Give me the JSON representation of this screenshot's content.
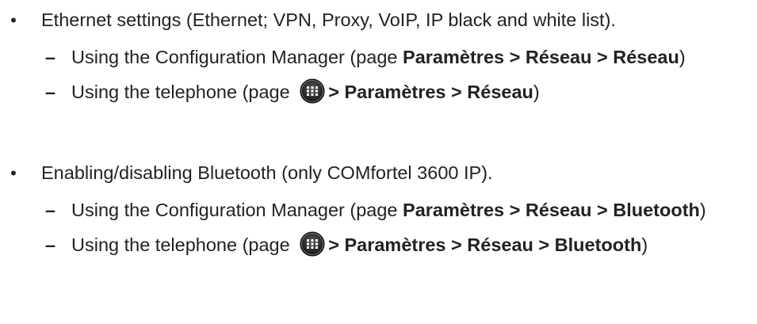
{
  "bullets": [
    {
      "text": "Ethernet settings (Ethernet; VPN, Proxy, VoIP, IP black and white list).",
      "items": [
        {
          "prefix": "Using the Configuration Manager (page ",
          "path": "Paramètres > Réseau > Réseau",
          "suffix": ")"
        },
        {
          "prefix": "Using the telephone (page ",
          "icon": "menu-grid-icon",
          "path": "> Paramètres > Réseau",
          "suffix": ")"
        }
      ]
    },
    {
      "text": "Enabling/disabling Bluetooth (only COMfortel 3600 IP).",
      "items": [
        {
          "prefix": "Using the Configuration Manager (page ",
          "path": "Paramètres > Réseau > Bluetooth",
          "suffix": ")"
        },
        {
          "prefix": "Using the telephone (page ",
          "icon": "menu-grid-icon",
          "path": "> Paramètres > Réseau > Bluetooth",
          "suffix": ")"
        }
      ]
    }
  ],
  "symbols": {
    "bullet": "•",
    "dash": "–"
  }
}
